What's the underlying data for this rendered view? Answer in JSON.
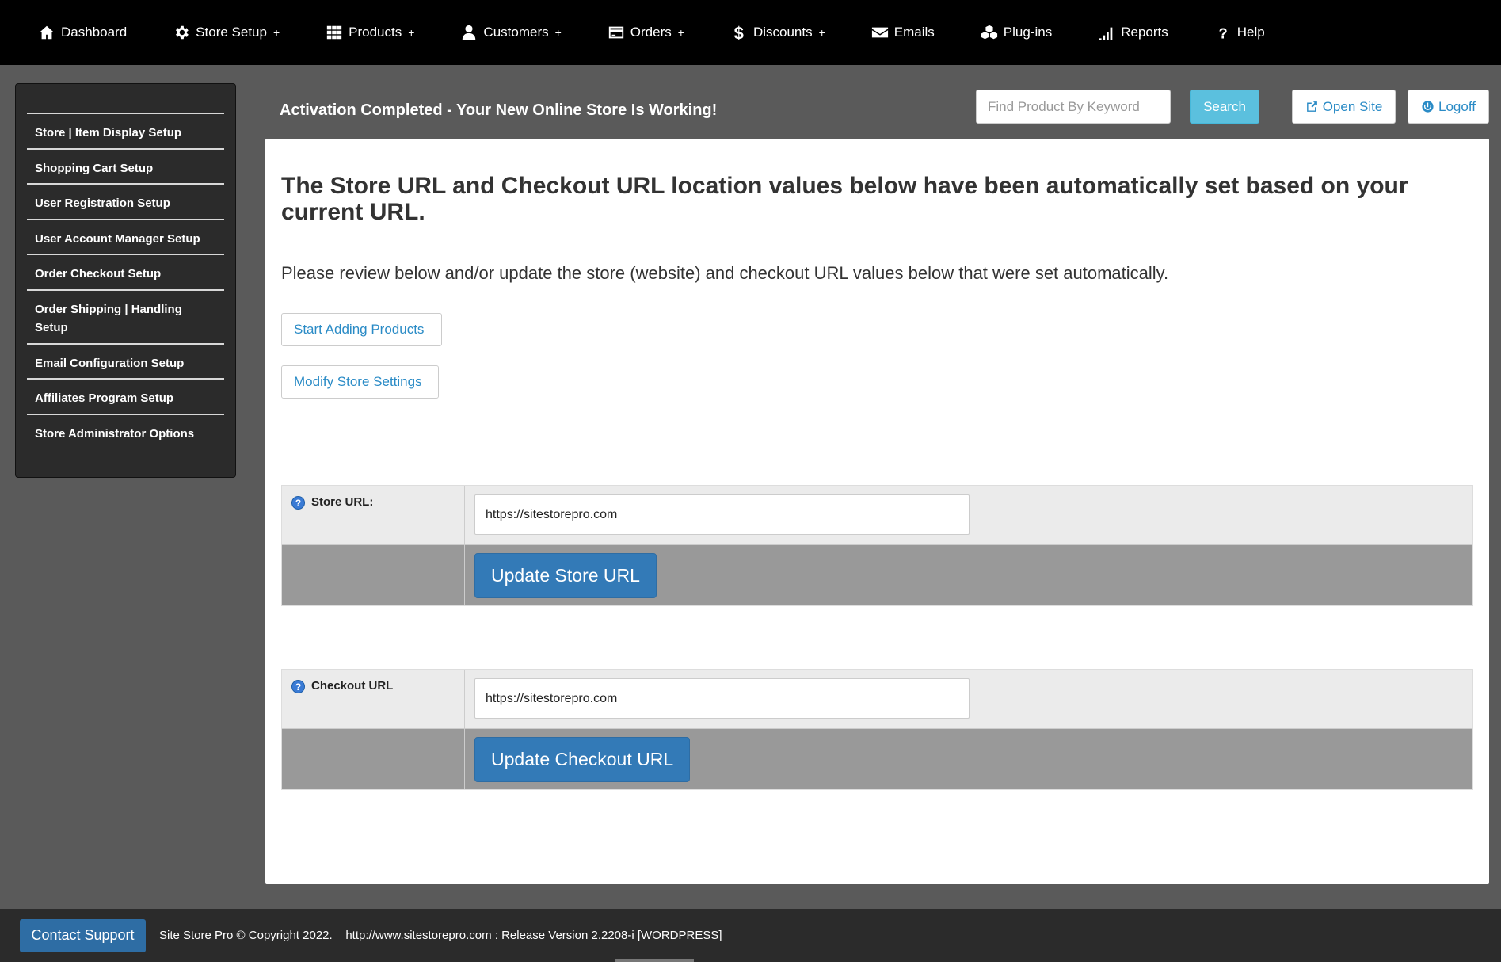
{
  "nav": [
    {
      "label": "Dashboard",
      "icon": "home-icon",
      "plus": false
    },
    {
      "label": "Store Setup",
      "icon": "gear-icon",
      "plus": true
    },
    {
      "label": "Products",
      "icon": "grid-icon",
      "plus": true
    },
    {
      "label": "Customers",
      "icon": "user-icon",
      "plus": true
    },
    {
      "label": "Orders",
      "icon": "credit-card-icon",
      "plus": true
    },
    {
      "label": "Discounts",
      "icon": "dollar-icon",
      "plus": true
    },
    {
      "label": "Emails",
      "icon": "envelope-icon",
      "plus": false
    },
    {
      "label": "Plug-ins",
      "icon": "cubes-icon",
      "plus": false
    },
    {
      "label": "Reports",
      "icon": "signal-icon",
      "plus": false
    },
    {
      "label": "Help",
      "icon": "question-icon",
      "plus": false
    }
  ],
  "nav_plus": "+",
  "sidebar": {
    "items": [
      "Store | Item Display Setup",
      "Shopping Cart Setup",
      "User Registration Setup",
      "User Account Manager Setup",
      "Order Checkout Setup",
      "Order Shipping | Handling Setup",
      "Email Configuration Setup",
      "Affiliates Program Setup",
      "Store Administrator Options"
    ]
  },
  "header": {
    "activation": "Activation Completed - Your New Online Store Is Working!",
    "search_placeholder": "Find Product By Keyword",
    "search_label": "Search",
    "open_site_label": "Open Site",
    "logoff_label": "Logoff"
  },
  "main": {
    "heading": "The Store URL and Checkout URL location values below have been automatically set based on your current URL.",
    "intro": "Please review below and/or update the store (website) and checkout URL values below that were set automatically.",
    "start_adding_label": "Start Adding Products",
    "modify_settings_label": "Modify Store Settings",
    "store_url": {
      "label": "Store URL:",
      "value": "https://sitestorepro.com",
      "button": "Update Store URL"
    },
    "checkout_url": {
      "label": "Checkout URL",
      "value": "https://sitestorepro.com",
      "button": "Update Checkout URL"
    }
  },
  "footer": {
    "contact_label": "Contact Support",
    "text": "Site Store Pro © Copyright 2022.    http://www.sitestorepro.com : Release Version 2.2208-i [WORDPRESS]"
  },
  "colors": {
    "nav_bg": "#000000",
    "page_bg": "#5a5a5a",
    "sidebar_bg": "#2b2b2b",
    "search_btn": "#5bc0de",
    "primary_btn": "#337ab7",
    "link": "#2a8bc6"
  }
}
